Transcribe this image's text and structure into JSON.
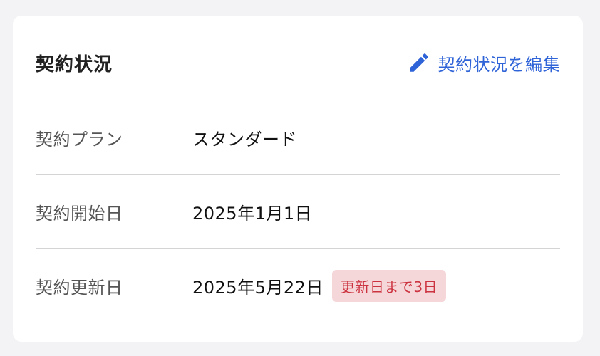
{
  "card": {
    "title": "契約状況",
    "edit_label": "契約状況を編集",
    "edit_icon": "pencil-icon"
  },
  "rows": [
    {
      "label": "契約プラン",
      "value": "スタンダード"
    },
    {
      "label": "契約開始日",
      "value": "2025年1月1日"
    },
    {
      "label": "契約更新日",
      "value": "2025年5月22日",
      "badge": "更新日まで3日"
    }
  ],
  "colors": {
    "accent": "#2f63d8",
    "badge_bg": "#f6d7d9",
    "badge_text": "#cc3340"
  }
}
